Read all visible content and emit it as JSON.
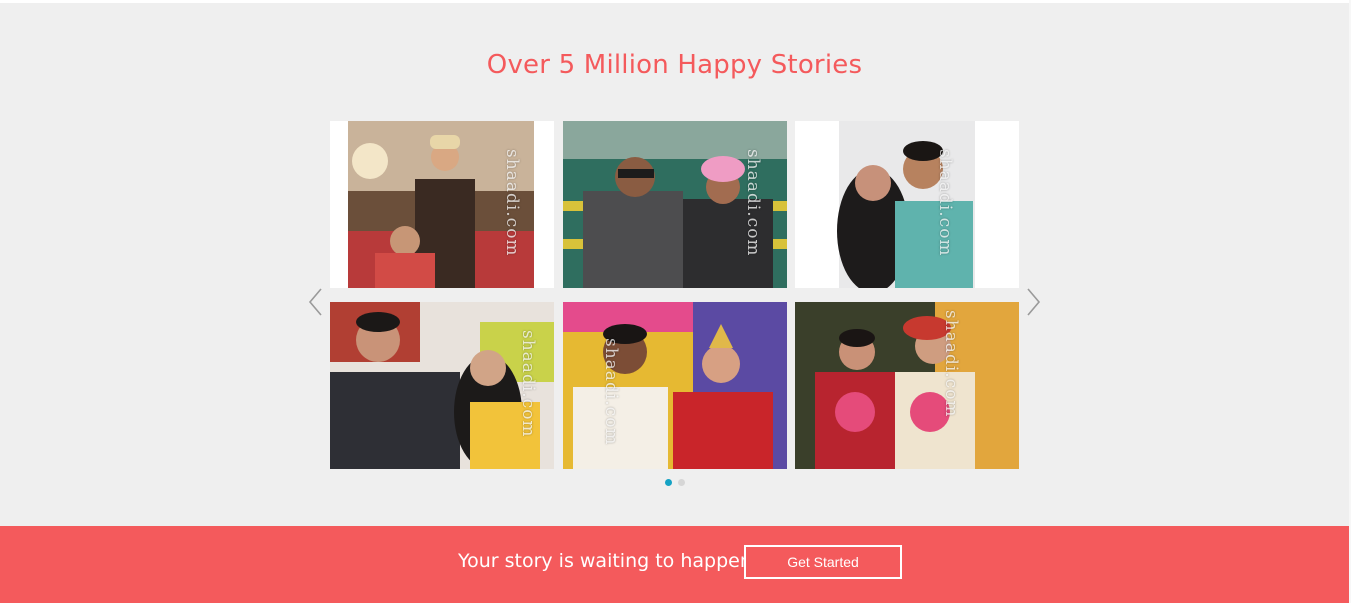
{
  "stories": {
    "title": "Over 5 Million Happy Stories",
    "photos": [
      {
        "alt": "Bride and groom in wedding attire",
        "watermark": "shaadi.com"
      },
      {
        "alt": "Couple outdoors in jackets",
        "watermark": "shaadi.com"
      },
      {
        "alt": "Couple selfie",
        "watermark": "shaadi.com"
      },
      {
        "alt": "Couple at celebration",
        "watermark": "shaadi.com"
      },
      {
        "alt": "Bengali wedding couple",
        "watermark": "shaadi.com"
      },
      {
        "alt": "Couple with garlands",
        "watermark": "shaadi.com"
      }
    ],
    "prev_icon": "chevron-left-icon",
    "next_icon": "chevron-right-icon",
    "pagination": {
      "pages": 2,
      "active": 1
    }
  },
  "cta": {
    "text": "Your story is waiting to happen!",
    "button_label": "Get Started"
  },
  "colors": {
    "accent": "#f45a5c",
    "section_bg": "#efefef",
    "dot_active": "#15a2c4",
    "dot_inactive": "#d6d6d6"
  }
}
